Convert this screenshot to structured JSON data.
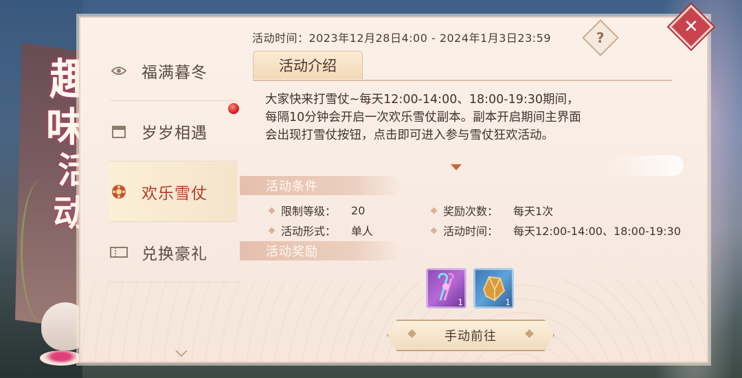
{
  "title_chars": [
    "趣",
    "味",
    "活",
    "动"
  ],
  "activity_time": "活动时间：2023年12月28日4:00 - 2024年1月3日23:59",
  "help_label": "?",
  "close_label": "✕",
  "sidebar": {
    "items": [
      {
        "label": "福满暮冬",
        "icon": "lantern-icon",
        "active": false
      },
      {
        "label": "岁岁相遇",
        "icon": "calendar-icon",
        "active": false
      },
      {
        "label": "欢乐雪仗",
        "icon": "snowball-icon",
        "active": true
      },
      {
        "label": "兑换豪礼",
        "icon": "ticket-icon",
        "active": false
      }
    ]
  },
  "tab_label": "活动介绍",
  "description": "大家快来打雪仗~每天12:00-14:00、18:00-19:30期间，每隔10分钟会开启一次欢乐雪仗副本。副本开启期间主界面会出现打雪仗按钮，点击即可进入参与雪仗狂欢活动。",
  "conditions": {
    "header": "活动条件",
    "items": [
      {
        "key": "限制等级：",
        "value": "20"
      },
      {
        "key": "奖励次数：",
        "value": "每天1次"
      },
      {
        "key": "活动形式：",
        "value": "单人"
      },
      {
        "key": "活动时间：",
        "value": "每天12:00-14:00、18:00-19:30"
      }
    ]
  },
  "rewards": {
    "header": "活动奖励",
    "items": [
      {
        "icon": "candy-cane-wand-icon",
        "count": "1",
        "color": "#9a55c4"
      },
      {
        "icon": "crystal-shard-icon",
        "count": "1",
        "color": "#4a86c6"
      }
    ]
  },
  "go_button": "手动前往",
  "colors": {
    "accent": "#b23c2c",
    "close": "#c9434f",
    "panel": "#fbf1e8"
  }
}
